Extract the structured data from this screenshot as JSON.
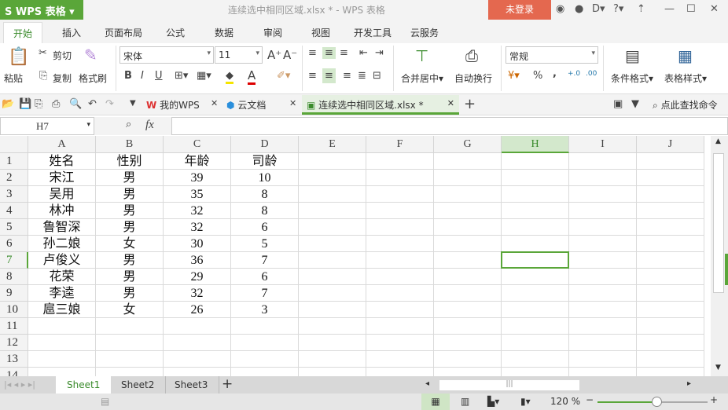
{
  "app": {
    "logo": "S WPS 表格",
    "title": "连续选中相同区域.xlsx * - WPS 表格",
    "login": "未登录"
  },
  "menu_tabs": [
    "开始",
    "插入",
    "页面布局",
    "公式",
    "数据",
    "审阅",
    "视图",
    "开发工具",
    "云服务"
  ],
  "ribbon": {
    "paste": "粘贴",
    "cut": "剪切",
    "copy": "复制",
    "format_painter": "格式刷",
    "font": "宋体",
    "font_size": "11",
    "bold": "B",
    "italic": "I",
    "underline": "U",
    "merge": "合并居中",
    "wrap": "自动换行",
    "number_format": "常规",
    "percent": "%",
    "comma": ",",
    "cond_format": "条件格式",
    "table_style": "表格样式"
  },
  "doc_tabs": [
    {
      "label": "我的WPS"
    },
    {
      "label": "云文档"
    },
    {
      "label": "连续选中相同区域.xlsx *"
    }
  ],
  "find_command": "点此查找命令",
  "formula_bar": {
    "cell_ref": "H7",
    "fx": "fx",
    "value": ""
  },
  "columns": [
    "A",
    "B",
    "C",
    "D",
    "E",
    "F",
    "G",
    "H",
    "I",
    "J"
  ],
  "rows": [
    [
      "姓名",
      "性别",
      "年龄",
      "司龄"
    ],
    [
      "宋江",
      "男",
      "39",
      "10"
    ],
    [
      "吴用",
      "男",
      "35",
      "8"
    ],
    [
      "林冲",
      "男",
      "32",
      "8"
    ],
    [
      "鲁智深",
      "男",
      "32",
      "6"
    ],
    [
      "孙二娘",
      "女",
      "30",
      "5"
    ],
    [
      "卢俊义",
      "男",
      "36",
      "7"
    ],
    [
      "花荣",
      "男",
      "29",
      "6"
    ],
    [
      "李逵",
      "男",
      "32",
      "7"
    ],
    [
      "扈三娘",
      "女",
      "26",
      "3"
    ],
    [
      "",
      "",
      "",
      ""
    ],
    [
      "",
      "",
      "",
      ""
    ],
    [
      "",
      "",
      "",
      ""
    ],
    [
      "",
      "",
      "",
      ""
    ]
  ],
  "selected_cell": "H7",
  "sheets": [
    "Sheet1",
    "Sheet2",
    "Sheet3"
  ],
  "active_sheet": "Sheet1",
  "zoom": "120 %",
  "zoom_value": 120,
  "colors": {
    "accent": "#5aa639",
    "login": "#e4684f"
  }
}
